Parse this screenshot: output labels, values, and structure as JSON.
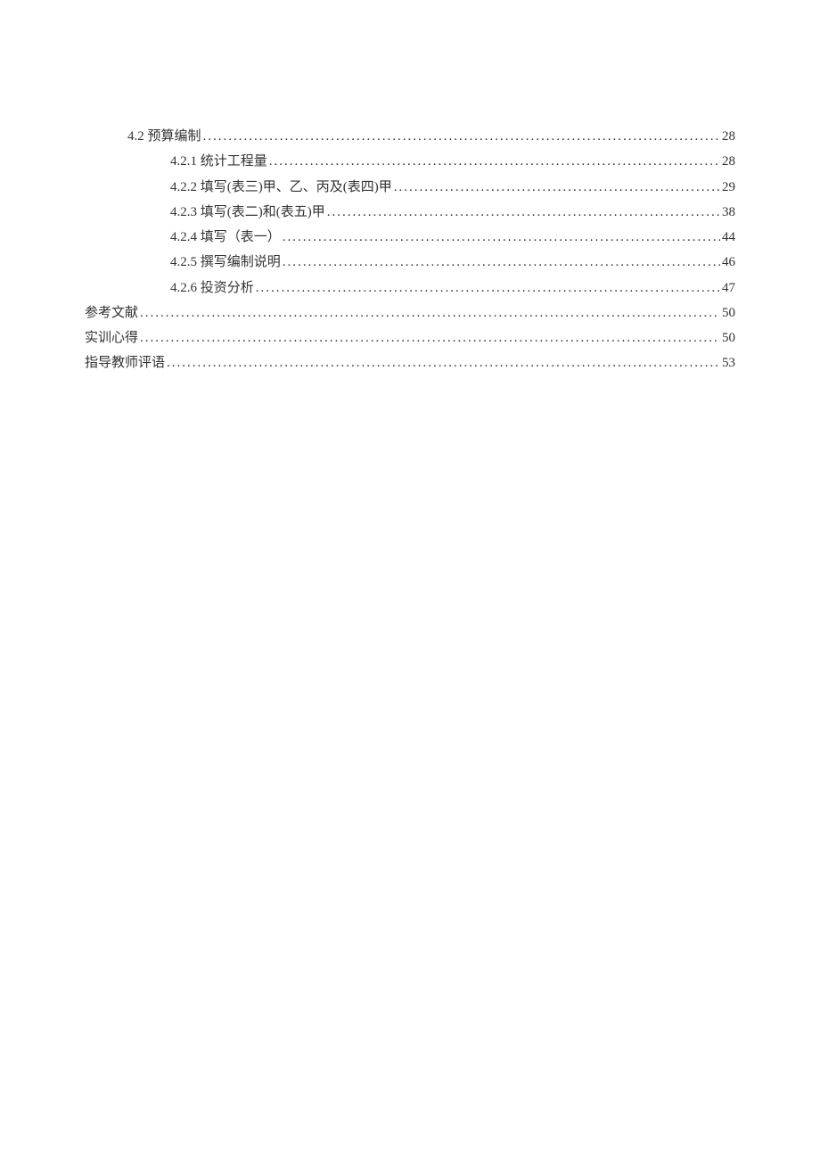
{
  "toc": [
    {
      "indent": 1,
      "label": "4.2  预算编制",
      "page": "28"
    },
    {
      "indent": 2,
      "label": "4.2.1  统计工程量",
      "page": "28"
    },
    {
      "indent": 2,
      "label": "4.2.2  填写(表三)甲、乙、丙及(表四)甲",
      "page": "29"
    },
    {
      "indent": 2,
      "label": "4.2.3  填写(表二)和(表五)甲",
      "page": "38"
    },
    {
      "indent": 2,
      "label": "4.2.4  填写（表一）",
      "page": "44"
    },
    {
      "indent": 2,
      "label": "4.2.5  撰写编制说明",
      "page": "46"
    },
    {
      "indent": 2,
      "label": "4.2.6  投资分析",
      "page": "47"
    },
    {
      "indent": 0,
      "label": "参考文献",
      "page": "50"
    },
    {
      "indent": 0,
      "label": "实训心得",
      "page": "50"
    },
    {
      "indent": 0,
      "label": "指导教师评语",
      "page": "53"
    }
  ]
}
